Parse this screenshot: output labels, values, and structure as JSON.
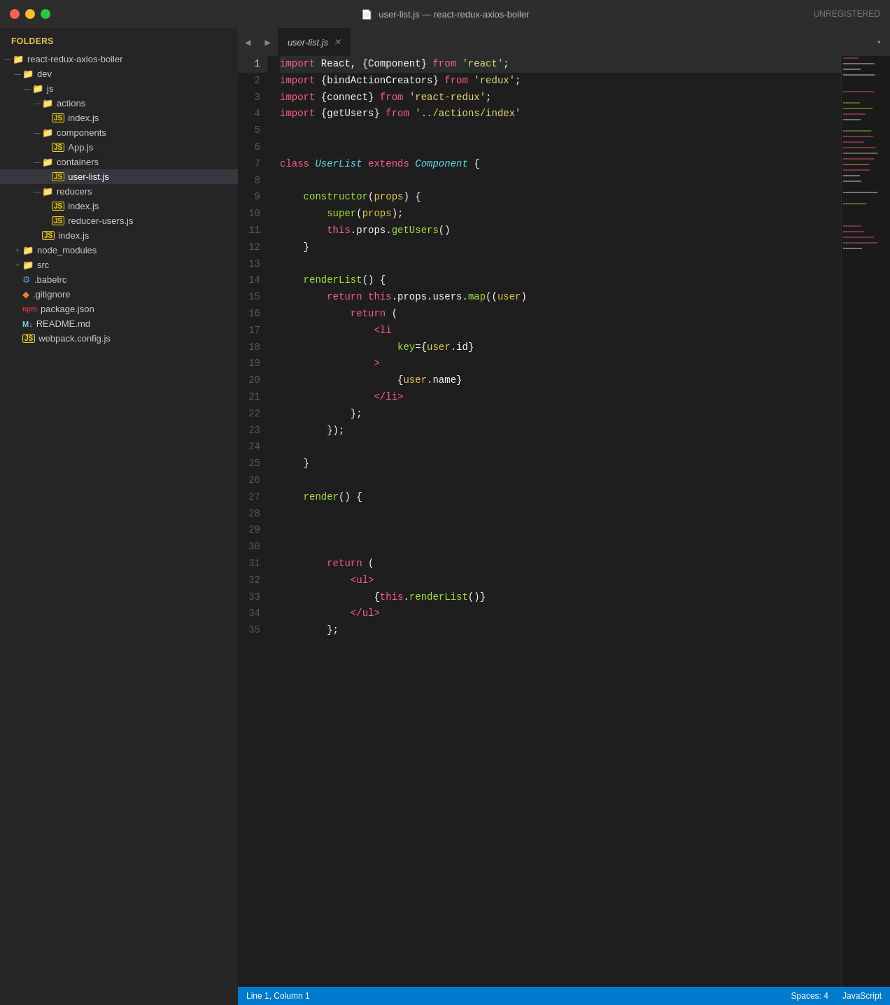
{
  "titlebar": {
    "title": "user-list.js — react-redux-axios-boiler",
    "unregistered": "UNREGISTERED"
  },
  "sidebar": {
    "header": "FOLDERS",
    "tree": [
      {
        "id": "root",
        "label": "react-redux-axios-boiler",
        "type": "folder",
        "indent": 0,
        "expanded": true,
        "arrow": "—"
      },
      {
        "id": "dev",
        "label": "dev",
        "type": "folder",
        "indent": 1,
        "expanded": true,
        "arrow": "—"
      },
      {
        "id": "js",
        "label": "js",
        "type": "folder",
        "indent": 2,
        "expanded": true,
        "arrow": "—"
      },
      {
        "id": "actions",
        "label": "actions",
        "type": "folder",
        "indent": 3,
        "expanded": true,
        "arrow": "—"
      },
      {
        "id": "actions-index",
        "label": "index.js",
        "type": "js",
        "indent": 4,
        "arrow": ""
      },
      {
        "id": "components",
        "label": "components",
        "type": "folder",
        "indent": 3,
        "expanded": true,
        "arrow": "—"
      },
      {
        "id": "components-app",
        "label": "App.js",
        "type": "js",
        "indent": 4,
        "arrow": ""
      },
      {
        "id": "containers",
        "label": "containers",
        "type": "folder",
        "indent": 3,
        "expanded": true,
        "arrow": "—"
      },
      {
        "id": "containers-userlist",
        "label": "user-list.js",
        "type": "js",
        "indent": 4,
        "arrow": "",
        "active": true
      },
      {
        "id": "reducers",
        "label": "reducers",
        "type": "folder",
        "indent": 3,
        "expanded": true,
        "arrow": "—"
      },
      {
        "id": "reducers-index",
        "label": "index.js",
        "type": "js",
        "indent": 4,
        "arrow": ""
      },
      {
        "id": "reducers-users",
        "label": "reducer-users.js",
        "type": "js",
        "indent": 4,
        "arrow": ""
      },
      {
        "id": "dev-index",
        "label": "index.js",
        "type": "js",
        "indent": 3,
        "arrow": ""
      },
      {
        "id": "node_modules",
        "label": "node_modules",
        "type": "folder",
        "indent": 1,
        "expanded": false,
        "arrow": "+"
      },
      {
        "id": "src",
        "label": "src",
        "type": "folder",
        "indent": 1,
        "expanded": false,
        "arrow": "+"
      },
      {
        "id": "babelrc",
        "label": ".babelrc",
        "type": "gear",
        "indent": 1,
        "arrow": ""
      },
      {
        "id": "gitignore",
        "label": ".gitignore",
        "type": "git",
        "indent": 1,
        "arrow": ""
      },
      {
        "id": "packagejson",
        "label": "package.json",
        "type": "npm",
        "indent": 1,
        "arrow": ""
      },
      {
        "id": "readme",
        "label": "README.md",
        "type": "md",
        "indent": 1,
        "arrow": ""
      },
      {
        "id": "webpack",
        "label": "webpack.config.js",
        "type": "js",
        "indent": 1,
        "arrow": ""
      }
    ]
  },
  "tabs": {
    "active": "user-list.js",
    "items": [
      {
        "label": "user-list.js"
      }
    ]
  },
  "code": {
    "lines": [
      {
        "num": 1,
        "tokens": [
          {
            "t": "kw",
            "v": "import"
          },
          {
            "t": "w",
            "v": " React, {Component} "
          },
          {
            "t": "kw",
            "v": "from"
          },
          {
            "t": "w",
            "v": " "
          },
          {
            "t": "str",
            "v": "'react'"
          },
          {
            "t": "w",
            "v": ";"
          }
        ]
      },
      {
        "num": 2,
        "tokens": [
          {
            "t": "kw",
            "v": "import"
          },
          {
            "t": "w",
            "v": " "
          },
          {
            "t": "curly",
            "v": "{bindActionCreators}"
          },
          {
            "t": "w",
            "v": " "
          },
          {
            "t": "kw",
            "v": "from"
          },
          {
            "t": "w",
            "v": " "
          },
          {
            "t": "str",
            "v": "'redux'"
          },
          {
            "t": "w",
            "v": ";"
          }
        ]
      },
      {
        "num": 3,
        "tokens": [
          {
            "t": "kw",
            "v": "import"
          },
          {
            "t": "w",
            "v": " "
          },
          {
            "t": "curly",
            "v": "{connect}"
          },
          {
            "t": "w",
            "v": " "
          },
          {
            "t": "kw",
            "v": "from"
          },
          {
            "t": "w",
            "v": " "
          },
          {
            "t": "str",
            "v": "'react-redux'"
          },
          {
            "t": "w",
            "v": ";"
          }
        ]
      },
      {
        "num": 4,
        "tokens": [
          {
            "t": "kw",
            "v": "import"
          },
          {
            "t": "w",
            "v": " "
          },
          {
            "t": "curly",
            "v": "{getUsers}"
          },
          {
            "t": "w",
            "v": " "
          },
          {
            "t": "kw",
            "v": "from"
          },
          {
            "t": "w",
            "v": " "
          },
          {
            "t": "str",
            "v": "'../actions/index'"
          }
        ]
      },
      {
        "num": 5,
        "tokens": []
      },
      {
        "num": 6,
        "tokens": []
      },
      {
        "num": 7,
        "tokens": [
          {
            "t": "kw",
            "v": "class"
          },
          {
            "t": "w",
            "v": " "
          },
          {
            "t": "cls",
            "v": "UserList"
          },
          {
            "t": "w",
            "v": " "
          },
          {
            "t": "kw",
            "v": "extends"
          },
          {
            "t": "w",
            "v": " "
          },
          {
            "t": "cls",
            "v": "Component"
          },
          {
            "t": "w",
            "v": " {"
          }
        ]
      },
      {
        "num": 8,
        "tokens": []
      },
      {
        "num": 9,
        "tokens": [
          {
            "t": "indent",
            "v": "    "
          },
          {
            "t": "cyan",
            "v": "constructor"
          },
          {
            "t": "paren",
            "v": "("
          },
          {
            "t": "yellow",
            "v": "props"
          },
          {
            "t": "paren",
            "v": ")"
          },
          {
            "t": "w",
            "v": " {"
          }
        ]
      },
      {
        "num": 10,
        "tokens": [
          {
            "t": "indent",
            "v": "        "
          },
          {
            "t": "cyan",
            "v": "super"
          },
          {
            "t": "paren",
            "v": "("
          },
          {
            "t": "yellow",
            "v": "props"
          },
          {
            "t": "paren",
            "v": ")"
          },
          {
            "t": "w",
            "v": ";"
          }
        ]
      },
      {
        "num": 11,
        "tokens": [
          {
            "t": "indent",
            "v": "        "
          },
          {
            "t": "kw",
            "v": "this"
          },
          {
            "t": "w",
            "v": ".props."
          },
          {
            "t": "cyan",
            "v": "getUsers"
          },
          {
            "t": "paren",
            "v": "()"
          }
        ]
      },
      {
        "num": 12,
        "tokens": [
          {
            "t": "indent",
            "v": "    "
          },
          {
            "t": "w",
            "v": "}"
          }
        ]
      },
      {
        "num": 13,
        "tokens": []
      },
      {
        "num": 14,
        "tokens": [
          {
            "t": "indent",
            "v": "    "
          },
          {
            "t": "cyan",
            "v": "renderList"
          },
          {
            "t": "paren",
            "v": "()"
          },
          {
            "t": "w",
            "v": " {"
          }
        ]
      },
      {
        "num": 15,
        "tokens": [
          {
            "t": "indent",
            "v": "        "
          },
          {
            "t": "kw",
            "v": "return"
          },
          {
            "t": "w",
            "v": " "
          },
          {
            "t": "kw",
            "v": "this"
          },
          {
            "t": "w",
            "v": ".props.users."
          },
          {
            "t": "cyan",
            "v": "map"
          },
          {
            "t": "paren",
            "v": "(("
          },
          {
            "t": "yellow",
            "v": "user"
          },
          {
            "t": "paren",
            "v": ")"
          }
        ]
      },
      {
        "num": 16,
        "tokens": [
          {
            "t": "indent",
            "v": "            "
          },
          {
            "t": "kw",
            "v": "return"
          },
          {
            "t": "w",
            "v": " ("
          }
        ]
      },
      {
        "num": 17,
        "tokens": [
          {
            "t": "indent",
            "v": "                "
          },
          {
            "t": "tag",
            "v": "<li"
          }
        ]
      },
      {
        "num": 18,
        "tokens": [
          {
            "t": "indent",
            "v": "                    "
          },
          {
            "t": "attr",
            "v": "key"
          },
          {
            "t": "w",
            "v": "={"
          },
          {
            "t": "yellow",
            "v": "user"
          },
          {
            "t": "w",
            "v": ".id}"
          }
        ]
      },
      {
        "num": 19,
        "tokens": [
          {
            "t": "indent",
            "v": "                "
          },
          {
            "t": "tag",
            "v": ">"
          }
        ]
      },
      {
        "num": 20,
        "tokens": [
          {
            "t": "indent",
            "v": "                    "
          },
          {
            "t": "w",
            "v": "{"
          },
          {
            "t": "yellow",
            "v": "user"
          },
          {
            "t": "w",
            "v": ".name}"
          }
        ]
      },
      {
        "num": 21,
        "tokens": [
          {
            "t": "indent",
            "v": "                "
          },
          {
            "t": "tag",
            "v": "</li>"
          }
        ]
      },
      {
        "num": 22,
        "tokens": [
          {
            "t": "indent",
            "v": "            "
          },
          {
            "t": "w",
            "v": "};"
          }
        ]
      },
      {
        "num": 23,
        "tokens": [
          {
            "t": "indent",
            "v": "        "
          },
          {
            "t": "w",
            "v": "});"
          }
        ]
      },
      {
        "num": 24,
        "tokens": []
      },
      {
        "num": 25,
        "tokens": [
          {
            "t": "indent",
            "v": "    "
          },
          {
            "t": "w",
            "v": "}"
          }
        ]
      },
      {
        "num": 26,
        "tokens": []
      },
      {
        "num": 27,
        "tokens": [
          {
            "t": "indent",
            "v": "    "
          },
          {
            "t": "cyan",
            "v": "render"
          },
          {
            "t": "paren",
            "v": "()"
          },
          {
            "t": "w",
            "v": " {"
          }
        ]
      },
      {
        "num": 28,
        "tokens": []
      },
      {
        "num": 29,
        "tokens": []
      },
      {
        "num": 30,
        "tokens": []
      },
      {
        "num": 31,
        "tokens": [
          {
            "t": "indent",
            "v": "        "
          },
          {
            "t": "kw",
            "v": "return"
          },
          {
            "t": "w",
            "v": " ("
          }
        ]
      },
      {
        "num": 32,
        "tokens": [
          {
            "t": "indent",
            "v": "            "
          },
          {
            "t": "tag",
            "v": "<ul>"
          }
        ]
      },
      {
        "num": 33,
        "tokens": [
          {
            "t": "indent",
            "v": "                "
          },
          {
            "t": "w",
            "v": "{"
          },
          {
            "t": "kw",
            "v": "this"
          },
          {
            "t": "w",
            "v": "."
          },
          {
            "t": "cyan",
            "v": "renderList"
          },
          {
            "t": "paren",
            "v": "()"
          },
          {
            "t": "w",
            "v": "}"
          }
        ]
      },
      {
        "num": 34,
        "tokens": [
          {
            "t": "indent",
            "v": "            "
          },
          {
            "t": "tag",
            "v": "</ul>"
          }
        ]
      },
      {
        "num": 35,
        "tokens": [
          {
            "t": "indent",
            "v": "        "
          },
          {
            "t": "w",
            "v": "};"
          }
        ]
      }
    ]
  },
  "statusbar": {
    "left": "Line 1, Column 1",
    "spaces": "Spaces: 4",
    "language": "JavaScript"
  }
}
